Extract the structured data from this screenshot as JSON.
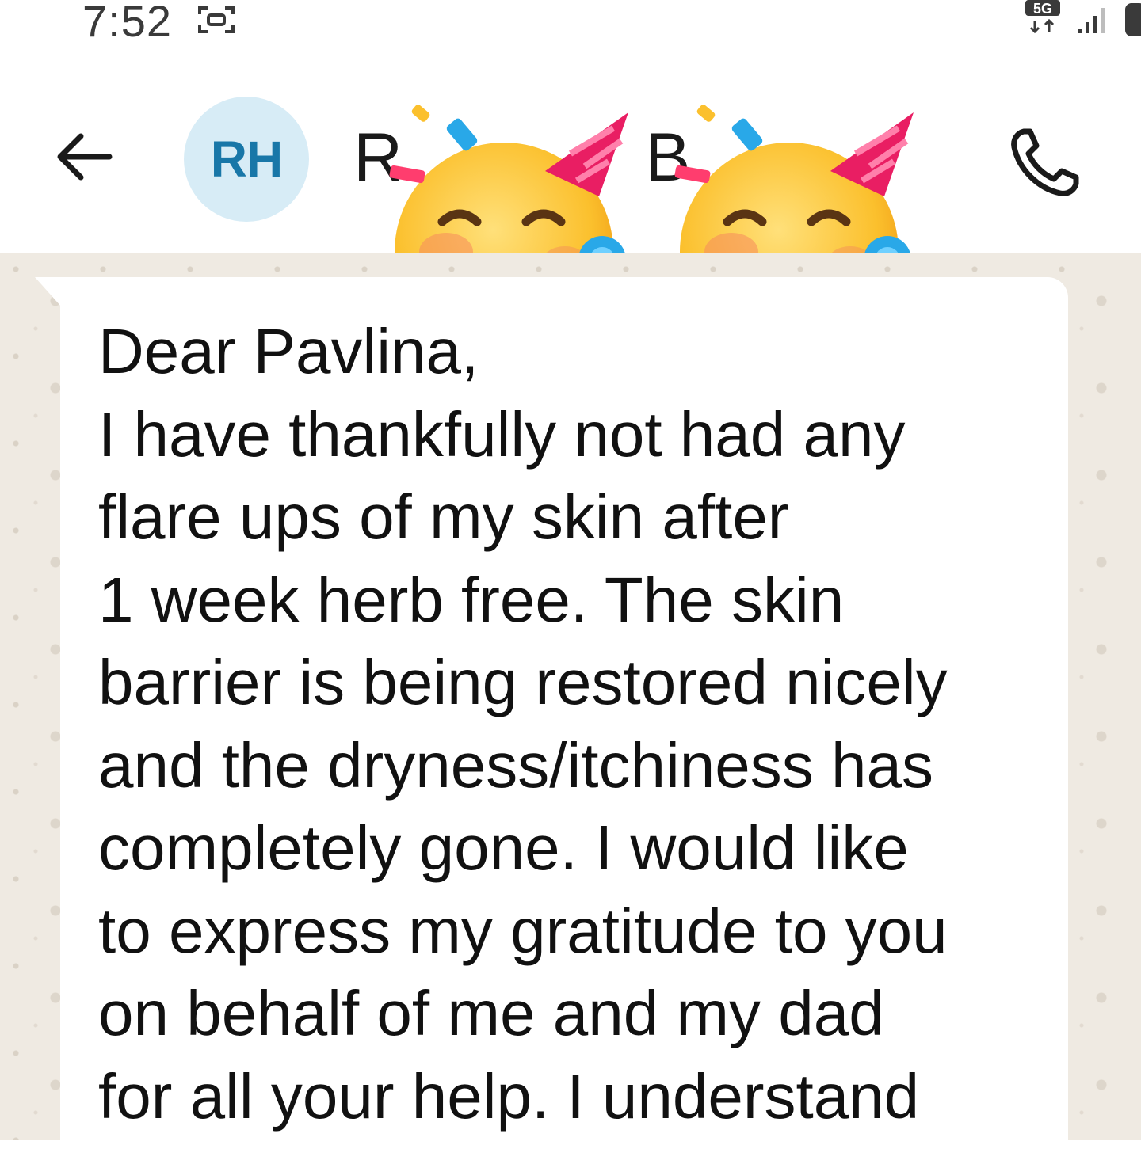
{
  "status_bar": {
    "time": "7:52",
    "network_label": "5G",
    "icons": [
      "screen-record-icon",
      "network-5g-icon",
      "signal-icon",
      "battery-icon"
    ]
  },
  "header": {
    "back_icon": "arrow-left-icon",
    "avatar_initials": "RH",
    "contact_name_visible_1": "R",
    "contact_name_visible_2": "B",
    "call_icon": "phone-icon",
    "stickers": [
      "party-face-emoji",
      "party-face-emoji"
    ]
  },
  "message": {
    "lines": [
      "Dear Pavlina,",
      "I have thankfully not had any",
      "flare ups of my skin after",
      "1 week herb free. The skin",
      "barrier is being restored nicely",
      "and the dryness/itchiness has",
      "completely gone. I would like",
      "to express my gratitude to you",
      "on behalf of me and my dad",
      "for all your help. I understand"
    ]
  },
  "colors": {
    "chat_background": "#efeae2",
    "bubble": "#ffffff",
    "avatar_bg": "#d7ecf6",
    "avatar_text": "#1877a8"
  }
}
